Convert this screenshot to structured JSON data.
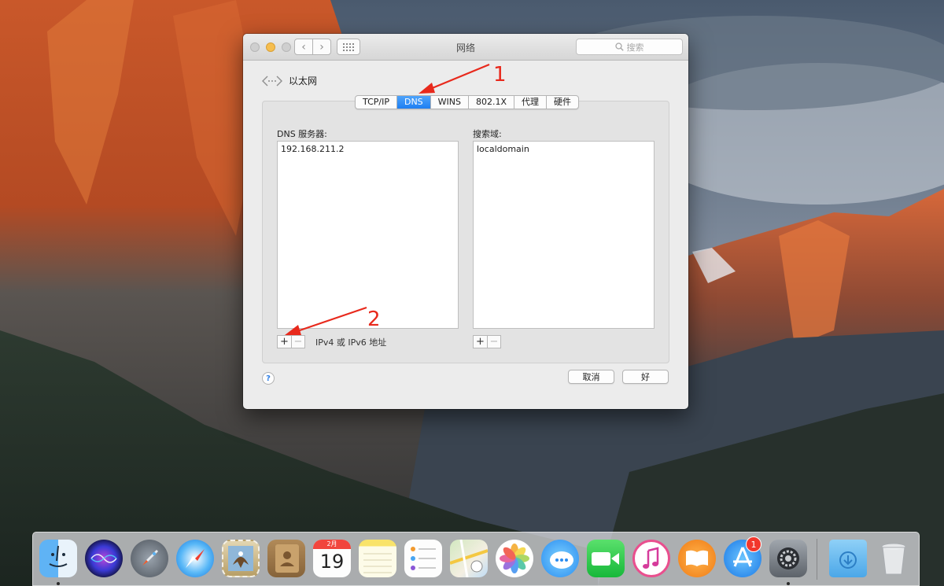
{
  "window": {
    "title": "网络",
    "search_placeholder": "搜索",
    "interface_name": "以太网"
  },
  "tabs": [
    {
      "label": "TCP/IP",
      "active": false
    },
    {
      "label": "DNS",
      "active": true
    },
    {
      "label": "WINS",
      "active": false
    },
    {
      "label": "802.1X",
      "active": false
    },
    {
      "label": "代理",
      "active": false
    },
    {
      "label": "硬件",
      "active": false
    }
  ],
  "dns": {
    "servers_label": "DNS 服务器:",
    "servers": [
      "192.168.211.2"
    ],
    "search_domains_label": "搜索域:",
    "search_domains": [
      "localdomain"
    ],
    "hint": "IPv4 或 IPv6 地址",
    "add_symbol": "+",
    "remove_symbol": "−"
  },
  "buttons": {
    "help": "?",
    "cancel": "取消",
    "ok": "好"
  },
  "annotations": {
    "step1": "1",
    "step2": "2",
    "color": "#e8291c"
  },
  "dock": {
    "items": [
      {
        "name": "finder",
        "icon": "finder-icon"
      },
      {
        "name": "siri",
        "icon": "siri-icon"
      },
      {
        "name": "launchpad",
        "icon": "rocket-icon"
      },
      {
        "name": "safari",
        "icon": "compass-icon"
      },
      {
        "name": "mail",
        "icon": "eagle-stamp-icon"
      },
      {
        "name": "contacts",
        "icon": "contacts-book-icon"
      },
      {
        "name": "calendar",
        "icon": "calendar-icon",
        "month": "2月",
        "day": "19"
      },
      {
        "name": "notes",
        "icon": "notes-icon"
      },
      {
        "name": "reminders",
        "icon": "reminders-icon"
      },
      {
        "name": "maps",
        "icon": "map-icon"
      },
      {
        "name": "photos",
        "icon": "photos-flower-icon"
      },
      {
        "name": "messages",
        "icon": "chat-bubble-icon"
      },
      {
        "name": "facetime",
        "icon": "video-camera-icon"
      },
      {
        "name": "itunes",
        "icon": "music-note-icon"
      },
      {
        "name": "ibooks",
        "icon": "book-icon"
      },
      {
        "name": "app-store",
        "icon": "app-store-icon",
        "badge": "1"
      },
      {
        "name": "system-preferences",
        "icon": "gear-icon"
      },
      {
        "name": "downloads",
        "icon": "downloads-folder-icon"
      },
      {
        "name": "trash",
        "icon": "trash-icon"
      }
    ],
    "accent": "#1d7ff2"
  }
}
